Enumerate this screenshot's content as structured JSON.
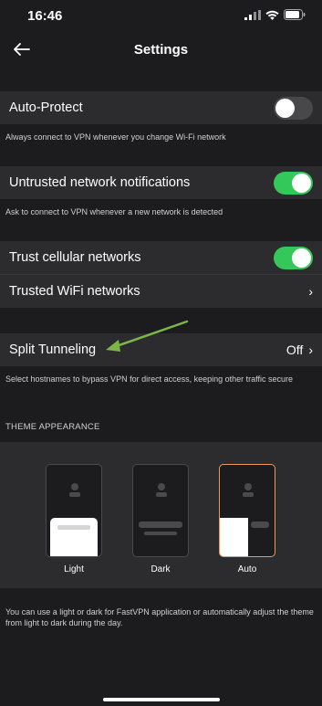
{
  "status": {
    "time": "16:46"
  },
  "nav": {
    "title": "Settings"
  },
  "auto_protect": {
    "label": "Auto-Protect",
    "enabled": false,
    "caption": "Always connect to VPN whenever you change Wi-Fi network"
  },
  "untrusted": {
    "label": "Untrusted network notifications",
    "enabled": true,
    "caption": "Ask to connect to VPN whenever a new network is detected"
  },
  "trust_cellular": {
    "label": "Trust cellular networks",
    "enabled": true
  },
  "trusted_wifi": {
    "label": "Trusted WiFi networks",
    "chevron": "›"
  },
  "split_tunneling": {
    "label": "Split Tunneling",
    "value": "Off",
    "chevron": "›",
    "caption": "Select hostnames to bypass VPN for direct access, keeping other traffic secure"
  },
  "theme": {
    "header": "THEME APPEARANCE",
    "options": [
      {
        "label": "Light",
        "selected": false
      },
      {
        "label": "Dark",
        "selected": false
      },
      {
        "label": "Auto",
        "selected": true
      }
    ],
    "footnote": "You can use a light or dark for FastVPN application or automatically adjust the theme from light to dark during the day."
  },
  "colors": {
    "background": "#1c1c1e",
    "row": "#2c2c2e",
    "toggle_on": "#34c759",
    "annotation_arrow": "#7ab648",
    "selected_border": "#e89a5c"
  },
  "icons": [
    "signal-icon",
    "wifi-icon",
    "battery-icon",
    "back-arrow-icon",
    "chevron-right-icon"
  ]
}
